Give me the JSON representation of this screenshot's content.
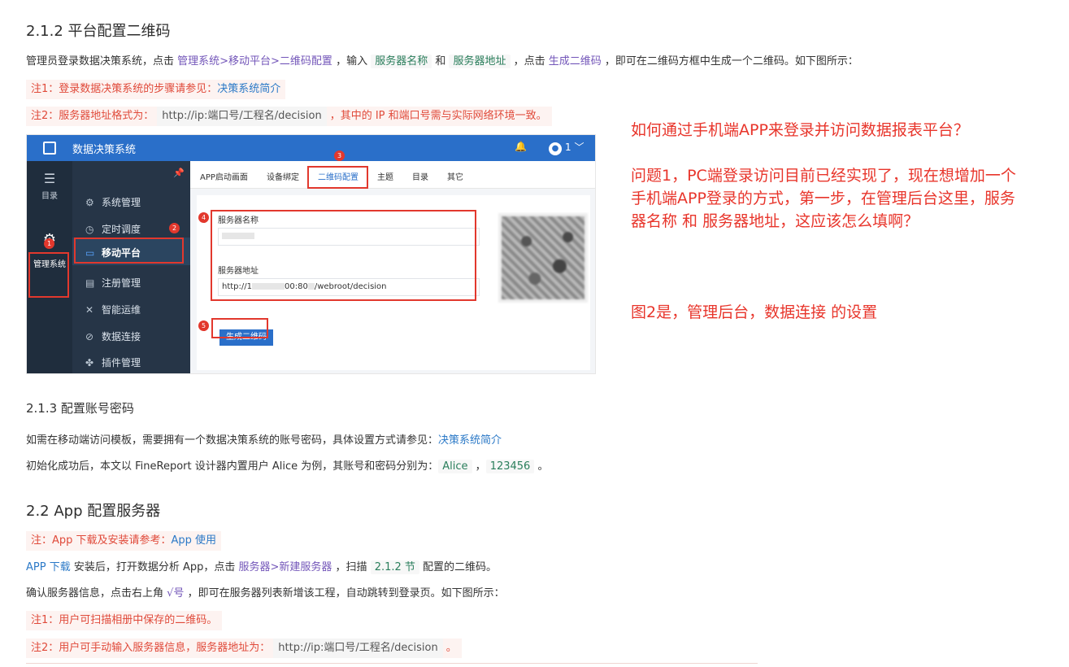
{
  "doc": {
    "h_211": "2.1.2 平台配置二维码",
    "p1": {
      "t1": "管理员登录数据决策系统，点击 ",
      "path": "管理系统>移动平台>二维码配置",
      "t2": " ，输入 ",
      "kw1": "服务器名称",
      "t3": " 和 ",
      "kw2": "服务器地址",
      "t4": " ，点击 ",
      "kw3": "生成二维码",
      "t5": " ，即可在二维码方框中生成一个二维码。如下图所示："
    },
    "note1": {
      "text": "注1：登录数据决策系统的步骤请参见：",
      "link": "决策系统简介"
    },
    "note2": {
      "text": "注2：服务器地址格式为：",
      "code": "http://ip:端口号/工程名/decision",
      "tail": "，其中的 IP 和端口号需与实际网络环境一致。"
    },
    "h_213": "2.1.3 配置账号密码",
    "p2": {
      "text": "如需在移动端访问模板，需要拥有一个数据决策系统的账号密码，具体设置方式请参见：",
      "link": "决策系统简介"
    },
    "p3": {
      "text": "初始化成功后，本文以 FineReport 设计器内置用户 Alice 为例，其账号和密码分别为：",
      "user": "Alice",
      "sep": " ，",
      "pwd": "123456",
      "end": " 。"
    },
    "h_22": "2.2 App 配置服务器",
    "note3": {
      "text": "注：App 下载及安装请参考：",
      "link": "App 使用"
    },
    "p4": {
      "link": "APP 下载",
      "t1": " 安装后，打开数据分析 App，点击 ",
      "path": "服务器>新建服务器",
      "t2": " ，扫描 ",
      "kw": "2.1.2 节",
      "t3": " 配置的二维码。"
    },
    "p5": {
      "t1": "确认服务器信息，点击右上角 ",
      "kw": "√号",
      "t2": " ，即可在服务器列表新增该工程，自动跳转到登录页。如下图所示："
    },
    "note4": {
      "text": "注1：用户可扫描相册中保存的二维码。"
    },
    "note5": {
      "text": "注2：用户可手动输入服务器信息，服务器地址为：",
      "code": "http://ip:端口号/工程名/decision",
      "tail": "。"
    }
  },
  "shot": {
    "app_title": "数据决策系统",
    "user_label": "1",
    "user_caret": "﹀",
    "rail": {
      "catalog": "目录",
      "manage": "管理系统"
    },
    "menu": [
      "系统管理",
      "定时调度",
      "移动平台",
      "注册管理",
      "智能运维",
      "数据连接",
      "插件管理"
    ],
    "tabs": [
      "APP启动画面",
      "设备绑定",
      "二维码配置",
      "主题",
      "目录",
      "其它"
    ],
    "field_name_label": "服务器名称",
    "field_addr_label": "服务器地址",
    "field_addr_value_a": "http://1",
    "field_addr_value_b": "00:80",
    "field_addr_value_c": "/webroot/decision",
    "gen_button": "生成二维码",
    "badges": [
      "1",
      "2",
      "3",
      "4",
      "5"
    ],
    "accent": "#2a6fc9",
    "highlight": "#e2382d"
  },
  "annotation": {
    "q_title": "如何通过手机端APP来登录并访问数据报表平台？",
    "q1_line1": "问题1，PC端登录访问目前已经实现了，现在想增加一个",
    "q1_line2": "手机端APP登录的方式，第一步，在管理后台这里，服务",
    "q1_line3": "器名称 和 服务器地址，这应该怎么填啊？",
    "q2": "图2是，管理后台，数据连接 的设置",
    "color": "#e8352b"
  }
}
